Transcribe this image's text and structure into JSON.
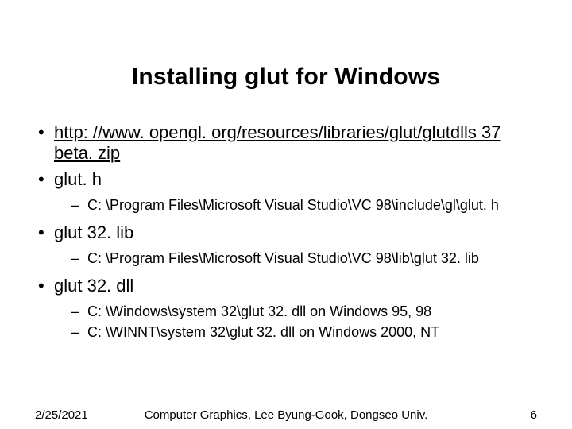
{
  "title": "Installing glut for Windows",
  "bullets": {
    "link": {
      "text": "http: //www. opengl. org/resources/libraries/glut/glutdlls 37 beta. zip",
      "href": "http://www.opengl.org/resources/libraries/glut/glutdlls37beta.zip"
    },
    "glut_h": {
      "label": "glut. h",
      "sub1": "C: \\Program Files\\Microsoft Visual Studio\\VC 98\\include\\gl\\glut. h"
    },
    "glut32_lib": {
      "label": "glut 32. lib",
      "sub1": "C: \\Program Files\\Microsoft Visual Studio\\VC 98\\lib\\glut 32. lib"
    },
    "glut32_dll": {
      "label": "glut 32. dll",
      "sub1": "C: \\Windows\\system 32\\glut 32. dll on Windows 95, 98",
      "sub2": "C: \\WINNT\\system 32\\glut 32. dll on Windows 2000, NT"
    }
  },
  "footer": {
    "date": "2/25/2021",
    "center": "Computer Graphics, Lee Byung-Gook, Dongseo Univ.",
    "page": "6"
  }
}
